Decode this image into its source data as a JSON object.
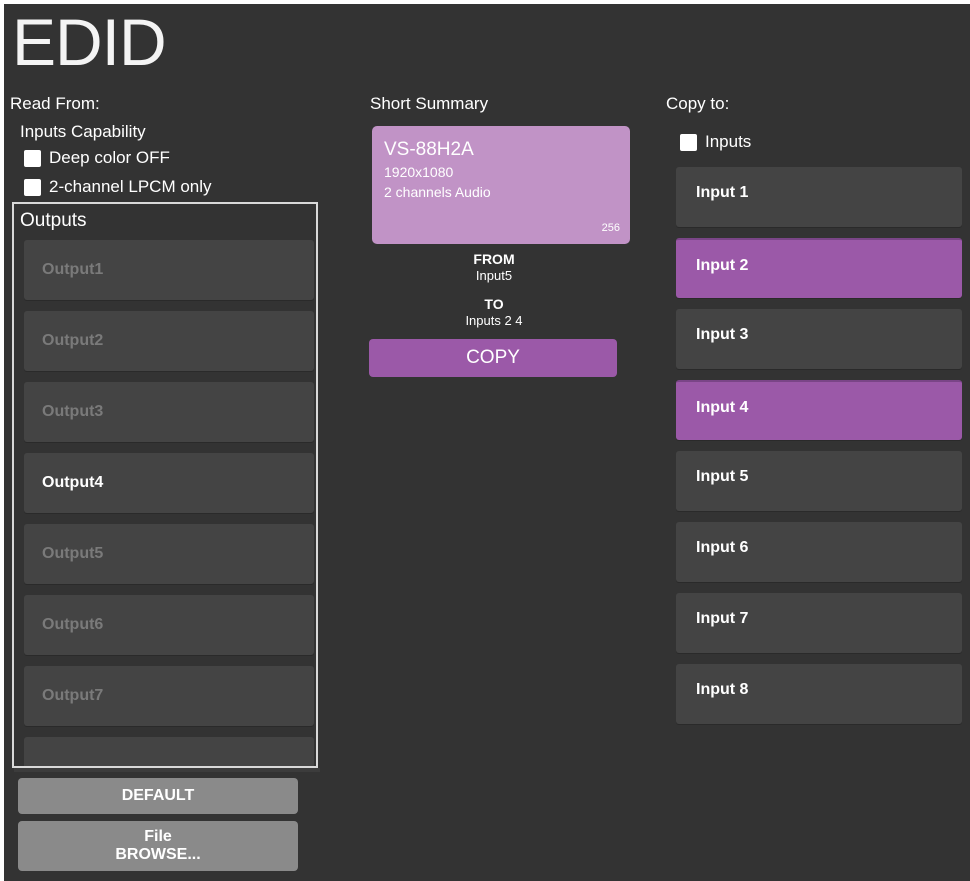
{
  "page": {
    "title": "EDID"
  },
  "read_from": {
    "label": "Read From:",
    "capability_label": "Inputs Capability",
    "options": [
      {
        "label": "Deep color OFF",
        "checked": false
      },
      {
        "label": "2-channel LPCM only",
        "checked": false
      }
    ],
    "outputs_title": "Outputs",
    "outputs": [
      {
        "label": "Output1",
        "active": false
      },
      {
        "label": "Output2",
        "active": false
      },
      {
        "label": "Output3",
        "active": false
      },
      {
        "label": "Output4",
        "active": true
      },
      {
        "label": "Output5",
        "active": false
      },
      {
        "label": "Output6",
        "active": false
      },
      {
        "label": "Output7",
        "active": false
      },
      {
        "label": "",
        "active": false
      }
    ],
    "default_button": "DEFAULT",
    "file_button_line1": "File",
    "file_button_line2": "BROWSE..."
  },
  "summary": {
    "label": "Short Summary",
    "device": "VS-88H2A",
    "resolution": "1920x1080",
    "audio": "2 channels Audio",
    "size": "256",
    "from_label": "FROM",
    "from_value": "Input5",
    "to_label": "TO",
    "to_value": "Inputs 2 4",
    "copy_button": "COPY"
  },
  "copy_to": {
    "label": "Copy to:",
    "all_inputs_label": "Inputs",
    "inputs": [
      {
        "label": "Input 1",
        "selected": false
      },
      {
        "label": "Input 2",
        "selected": true
      },
      {
        "label": "Input 3",
        "selected": false
      },
      {
        "label": "Input 4",
        "selected": true
      },
      {
        "label": "Input 5",
        "selected": false
      },
      {
        "label": "Input 6",
        "selected": false
      },
      {
        "label": "Input 7",
        "selected": false
      },
      {
        "label": "Input 8",
        "selected": false
      }
    ]
  },
  "colors": {
    "background": "#333333",
    "accent": "#9b59a8",
    "summary_card": "#c193c6",
    "tile": "#444444",
    "inactive_text": "#7a7a7a",
    "gray_button": "#8a8a8a"
  }
}
